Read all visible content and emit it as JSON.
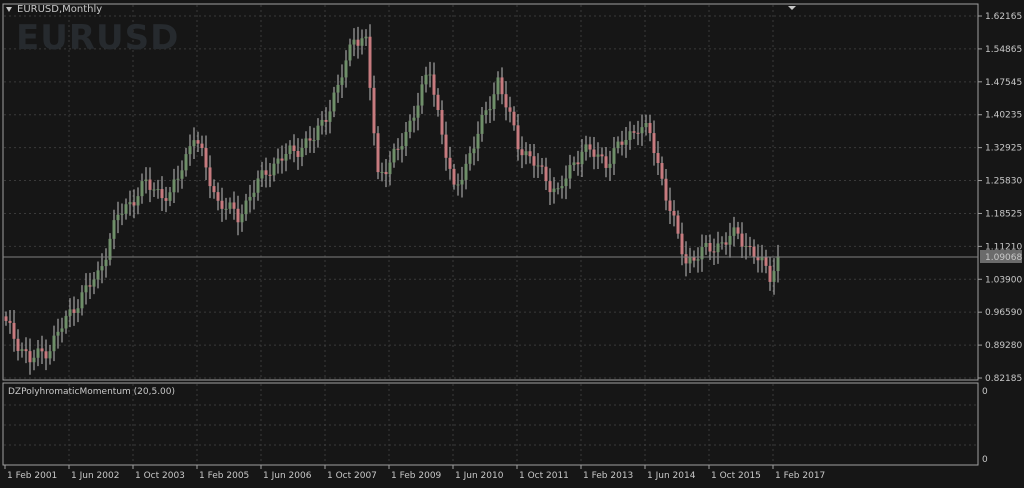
{
  "chart_title": "EURUSD,Monthly",
  "watermark": "EURUSD",
  "indicator_title": "DZPolyhromaticMomentum (20,5.00)",
  "current_price": "1.09068",
  "colors": {
    "background": "#161616",
    "bull": "#6f8f69",
    "bear": "#c77b7f",
    "grid": "#3a3a3a",
    "border": "#a0a0a0"
  },
  "price_ticks": [
    "1.62165",
    "1.54865",
    "1.47545",
    "1.40235",
    "1.32925",
    "1.25830",
    "1.18525",
    "1.11210",
    "1.03900",
    "0.96590",
    "0.89280",
    "0.82185"
  ],
  "indicator_ticks": [
    "0",
    "0"
  ],
  "date_ticks": [
    "1 Feb 2001",
    "1 Jun 2002",
    "1 Oct 2003",
    "1 Feb 2005",
    "1 Jun 2006",
    "1 Oct 2007",
    "1 Feb 2009",
    "1 Jun 2010",
    "1 Oct 2011",
    "1 Feb 2013",
    "1 Jun 2014",
    "1 Oct 2015",
    "1 Feb 2017"
  ],
  "chart_data": {
    "type": "candlestick",
    "series_anchor_points": [
      {
        "date": "2001-01",
        "close": 0.94
      },
      {
        "date": "2001-07",
        "close": 0.86
      },
      {
        "date": "2001-12",
        "close": 0.89
      },
      {
        "date": "2002-06",
        "close": 0.98
      },
      {
        "date": "2002-12",
        "close": 1.05
      },
      {
        "date": "2003-05",
        "close": 1.18
      },
      {
        "date": "2003-12",
        "close": 1.25
      },
      {
        "date": "2004-06",
        "close": 1.22
      },
      {
        "date": "2004-12",
        "close": 1.36
      },
      {
        "date": "2005-06",
        "close": 1.21
      },
      {
        "date": "2005-11",
        "close": 1.18
      },
      {
        "date": "2006-06",
        "close": 1.28
      },
      {
        "date": "2006-12",
        "close": 1.32
      },
      {
        "date": "2007-06",
        "close": 1.35
      },
      {
        "date": "2007-12",
        "close": 1.46
      },
      {
        "date": "2008-04",
        "close": 1.58
      },
      {
        "date": "2008-07",
        "close": 1.56
      },
      {
        "date": "2008-10",
        "close": 1.27
      },
      {
        "date": "2009-03",
        "close": 1.32
      },
      {
        "date": "2009-11",
        "close": 1.5
      },
      {
        "date": "2010-05",
        "close": 1.23
      },
      {
        "date": "2010-11",
        "close": 1.36
      },
      {
        "date": "2011-04",
        "close": 1.48
      },
      {
        "date": "2011-09",
        "close": 1.34
      },
      {
        "date": "2012-07",
        "close": 1.23
      },
      {
        "date": "2013-01",
        "close": 1.33
      },
      {
        "date": "2013-07",
        "close": 1.3
      },
      {
        "date": "2014-03",
        "close": 1.38
      },
      {
        "date": "2014-06",
        "close": 1.36
      },
      {
        "date": "2015-01",
        "close": 1.13
      },
      {
        "date": "2015-03",
        "close": 1.08
      },
      {
        "date": "2016-04",
        "close": 1.14
      },
      {
        "date": "2016-12",
        "close": 1.05
      },
      {
        "date": "2017-02",
        "close": 1.09
      }
    ],
    "ylim": [
      0.82185,
      1.62165
    ],
    "last_price": 1.09068
  }
}
